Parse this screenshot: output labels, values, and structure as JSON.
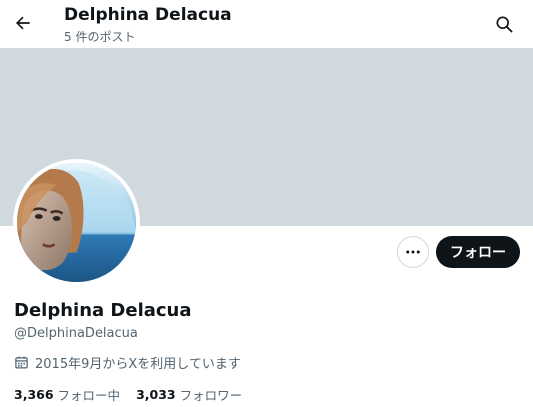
{
  "header": {
    "title": "Delphina Delacua",
    "post_count": "5 件のポスト"
  },
  "icons": {
    "back": "arrow-left-icon",
    "search": "search-icon",
    "more": "more-horizontal-icon",
    "calendar": "calendar-icon"
  },
  "profile": {
    "name": "Delphina Delacua",
    "handle": "@DelphinaDelacua",
    "joined": "2015年9月からXを利用しています",
    "following_count": "3,366",
    "following_label": "フォロー中",
    "followers_count": "3,033",
    "followers_label": "フォロワー"
  },
  "actions": {
    "follow_label": "フォロー"
  },
  "colors": {
    "banner": "#cfd9de",
    "text_primary": "#0f1419",
    "text_secondary": "#536471",
    "follow_button_bg": "#0f1419"
  }
}
